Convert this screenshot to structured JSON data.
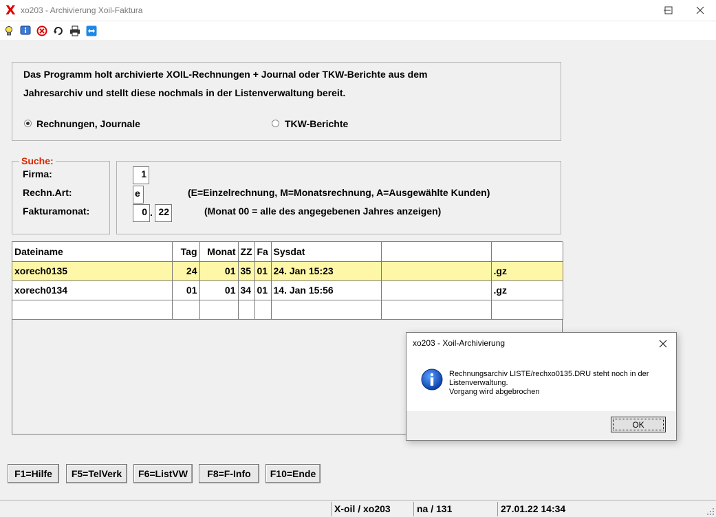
{
  "window": {
    "logo": "X",
    "title": "xo203 - Archivierung Xoil-Faktura"
  },
  "toolbar": {
    "icons": [
      "lightbulb-icon",
      "info-icon",
      "cancel-icon",
      "refresh-icon",
      "printer-icon",
      "remote-icon"
    ]
  },
  "intro": {
    "line1": "Das Programm holt archivierte XOIL-Rechnungen + Journal oder TKW-Berichte aus dem",
    "line2": "Jahresarchiv und stellt diese nochmals in der Listenverwaltung bereit.",
    "options": [
      {
        "label": "Rechnungen, Journale",
        "selected": true
      },
      {
        "label": "TKW-Berichte",
        "selected": false
      }
    ]
  },
  "search": {
    "legend": "Suche:",
    "labels": {
      "firma": "Firma:",
      "rechn_art": "Rechn.Art:",
      "fakturamonat": "Fakturamonat:"
    },
    "values": {
      "firma": "1",
      "rechn_art": "e",
      "monat": "0",
      "jahr": "22"
    },
    "separator": ".",
    "hint_art": "(E=Einzelrechnung, M=Monatsrechnung, A=Ausgewählte Kunden)",
    "hint_monat": "(Monat 00 = alle des angegebenen Jahres anzeigen)"
  },
  "table": {
    "headers": [
      "Dateiname",
      "Tag",
      "Monat",
      "ZZ",
      "Fa",
      "Sysdat",
      "",
      ""
    ],
    "rows": [
      [
        "xorech0135",
        "24",
        "01",
        "35",
        "01",
        "24. Jan 15:23",
        "",
        ".gz"
      ],
      [
        "xorech0134",
        "01",
        "01",
        "34",
        "01",
        "14. Jan 15:56",
        "",
        ".gz"
      ],
      [
        "",
        "",
        "",
        "",
        "",
        "",
        "",
        ""
      ]
    ]
  },
  "fkeys": [
    "F1=Hilfe",
    "F5=TelVerk",
    "F6=ListVW",
    "F8=F-Info",
    "F10=Ende"
  ],
  "status": {
    "app": "X-oil / xo203",
    "counter": "na / 131",
    "datetime": "27.01.22 14:34"
  },
  "dialog": {
    "title": "xo203 - Xoil-Archivierung",
    "message_line1": "Rechnungsarchiv LISTE/rechxo0135.DRU steht noch in der",
    "message_line2": "Listenverwaltung.",
    "message_line3": "Vorgang wird abgebrochen",
    "ok_label": "OK"
  },
  "colors": {
    "selected_row": "#fff7a8",
    "legend": "#d42a00",
    "logo": "#e00000"
  }
}
